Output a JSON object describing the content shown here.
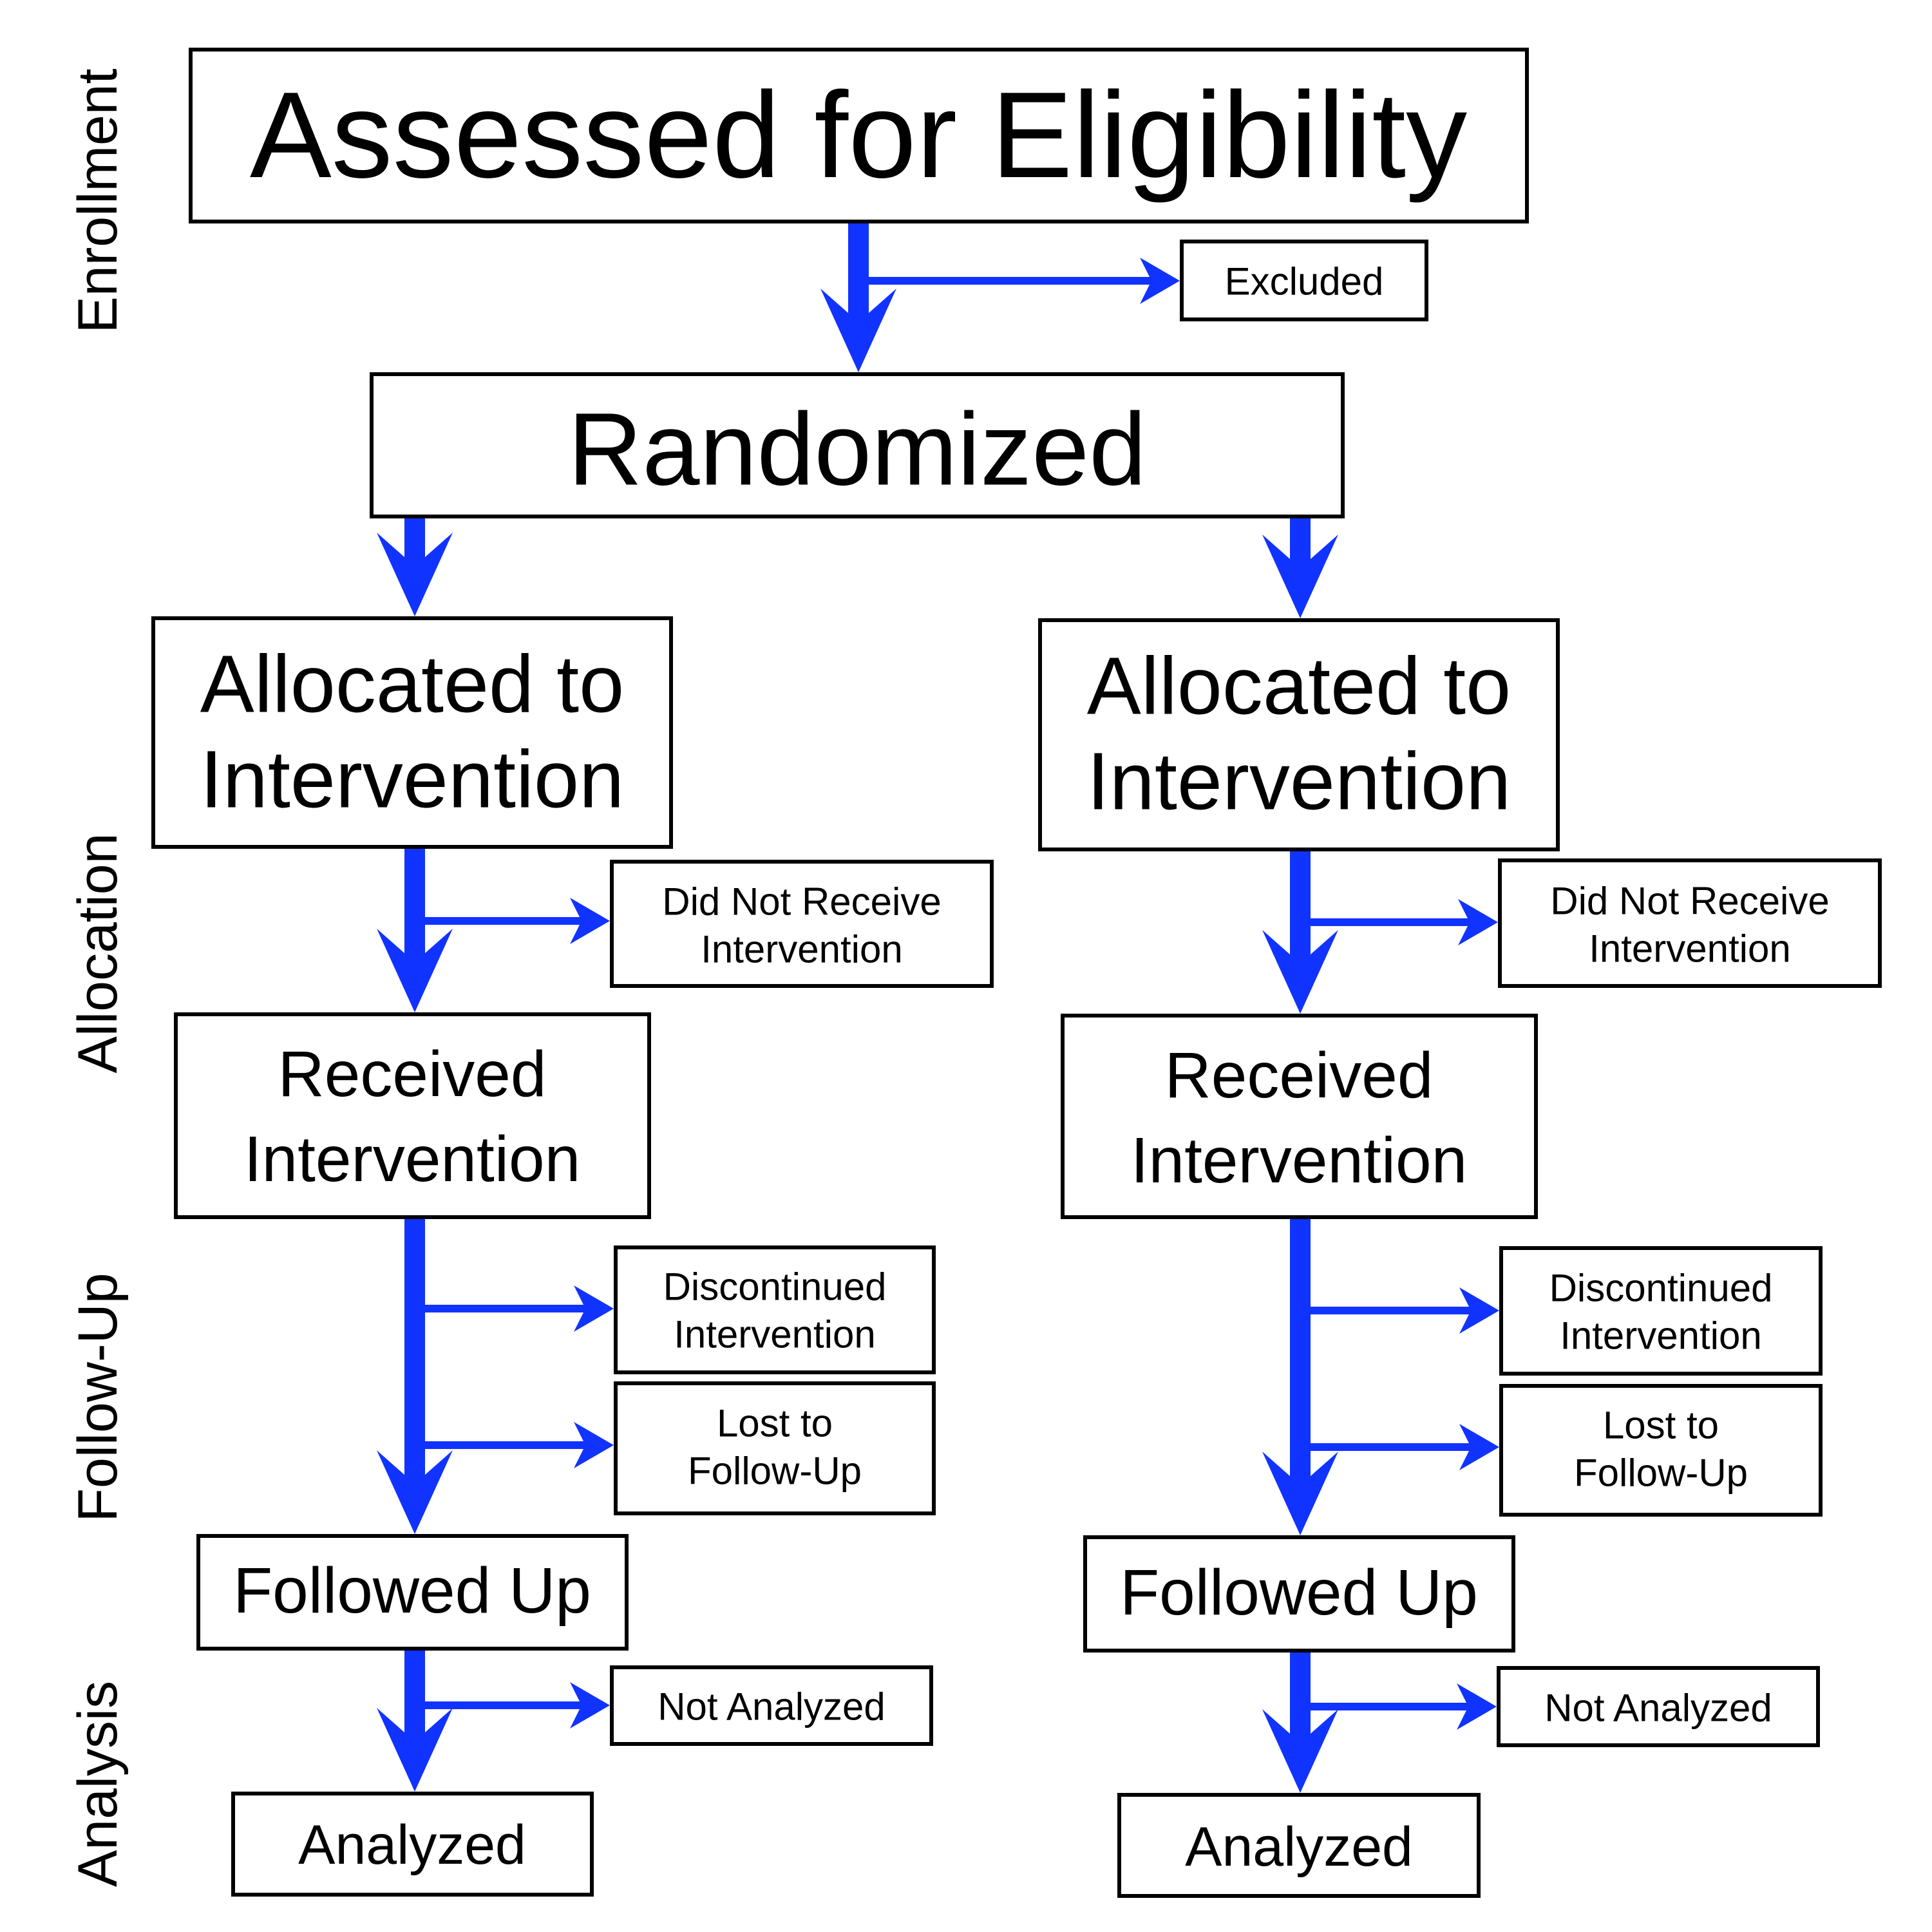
{
  "diagram": {
    "type": "CONSORT flow diagram",
    "arrow_color": "#1133FF",
    "phases": [
      "Enrollment",
      "Allocation",
      "Follow-Up",
      "Analysis"
    ],
    "nodes": {
      "assessed": "Assessed for Eligibility",
      "excluded": "Excluded",
      "randomized": "Randomized"
    },
    "arms": [
      {
        "allocated": [
          "Allocated to",
          "Intervention"
        ],
        "did_not_receive": [
          "Did Not Receive",
          "Intervention"
        ],
        "received": [
          "Received",
          "Intervention"
        ],
        "discontinued": [
          "Discontinued",
          "Intervention"
        ],
        "lost": [
          "Lost to",
          "Follow-Up"
        ],
        "followed_up": "Followed Up",
        "not_analyzed": "Not Analyzed",
        "analyzed": "Analyzed"
      },
      {
        "allocated": [
          "Allocated to",
          "Intervention"
        ],
        "did_not_receive": [
          "Did Not Receive",
          "Intervention"
        ],
        "received": [
          "Received",
          "Intervention"
        ],
        "discontinued": [
          "Discontinued",
          "Intervention"
        ],
        "lost": [
          "Lost to",
          "Follow-Up"
        ],
        "followed_up": "Followed Up",
        "not_analyzed": "Not Analyzed",
        "analyzed": "Analyzed"
      }
    ]
  }
}
